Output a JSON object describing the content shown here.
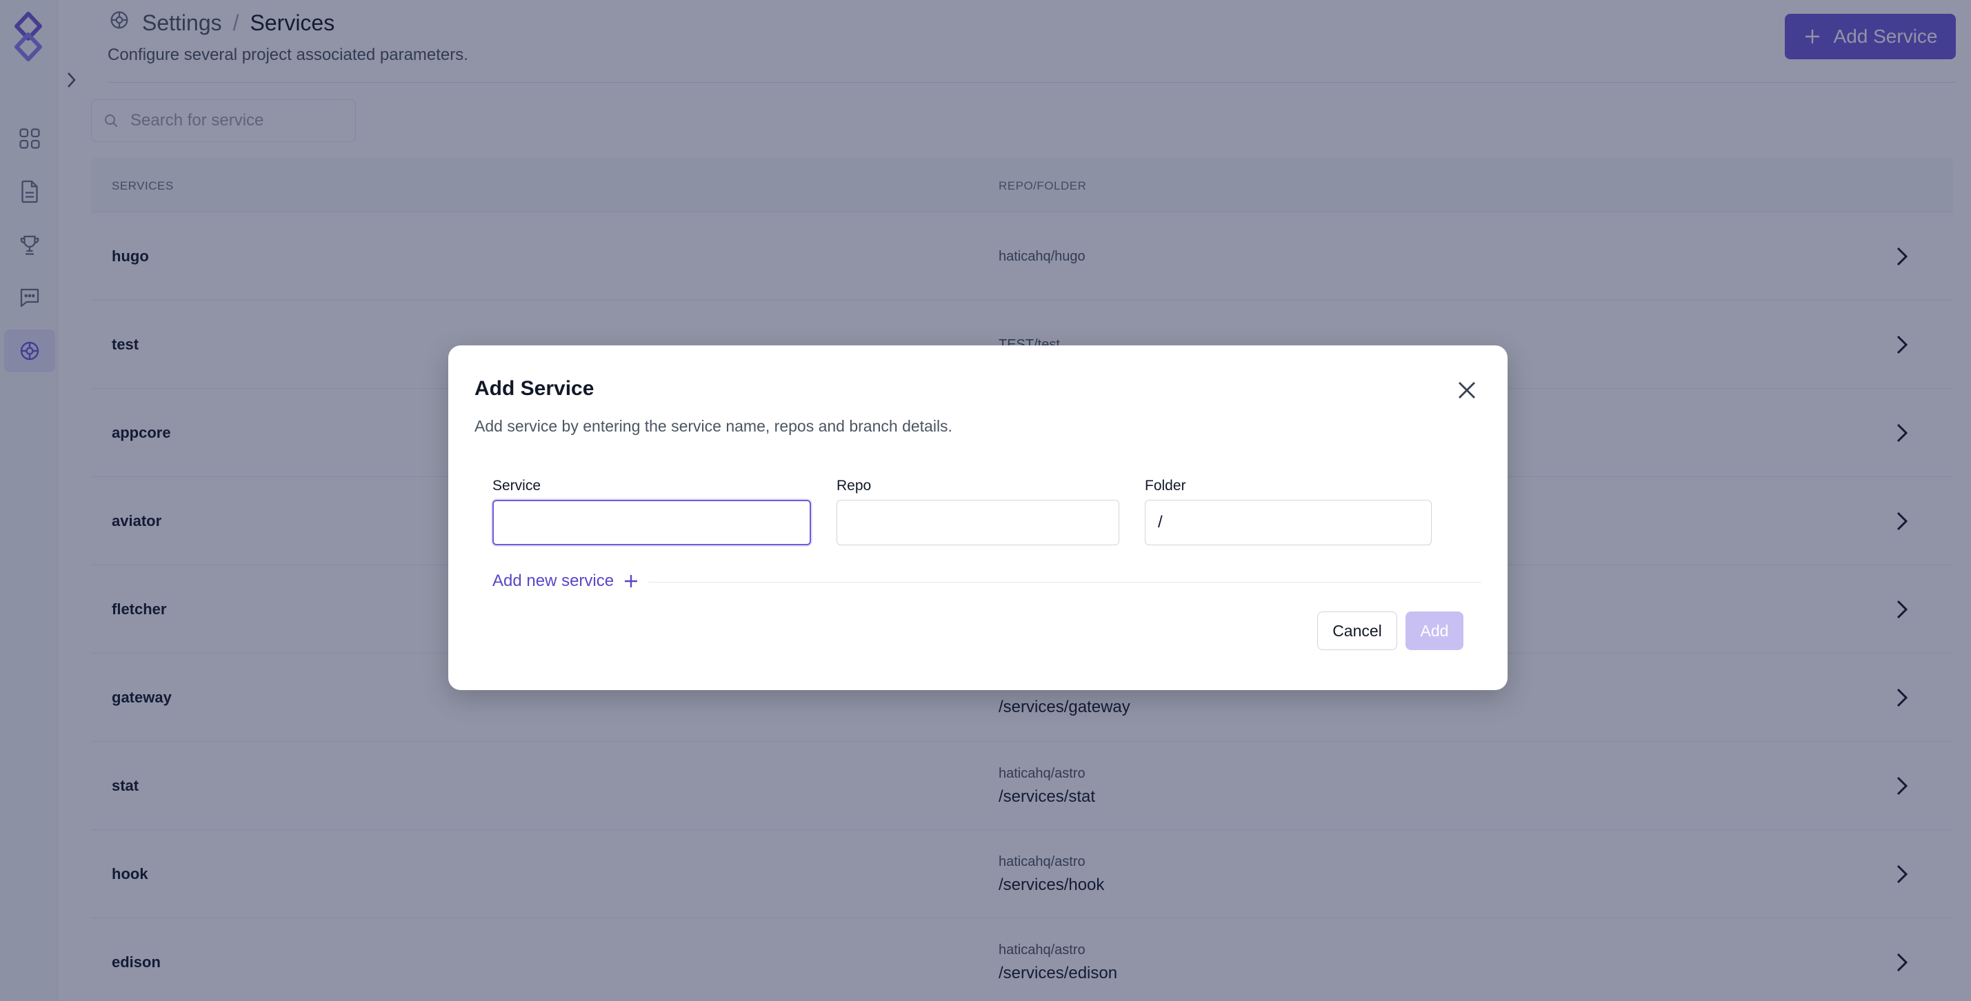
{
  "header": {
    "breadcrumb_root": "Settings",
    "breadcrumb_sep": "/",
    "breadcrumb_current": "Services",
    "subtitle": "Configure several project associated parameters.",
    "add_service_label": "Add Service"
  },
  "search": {
    "placeholder": "Search for service"
  },
  "table": {
    "col_services": "SERVICES",
    "col_repo": "REPO/FOLDER",
    "rows": [
      {
        "name": "hugo",
        "repo": "haticahq/hugo",
        "folder": ""
      },
      {
        "name": "test",
        "repo": "TEST/test",
        "folder": ""
      },
      {
        "name": "appcore",
        "repo": "",
        "folder": ""
      },
      {
        "name": "aviator",
        "repo": "",
        "folder": ""
      },
      {
        "name": "fletcher",
        "repo": "",
        "folder": ""
      },
      {
        "name": "gateway",
        "repo": "",
        "folder": "/services/gateway"
      },
      {
        "name": "stat",
        "repo": "haticahq/astro",
        "folder": "/services/stat"
      },
      {
        "name": "hook",
        "repo": "haticahq/astro",
        "folder": "/services/hook"
      },
      {
        "name": "edison",
        "repo": "haticahq/astro",
        "folder": "/services/edison"
      }
    ]
  },
  "modal": {
    "title": "Add Service",
    "description": "Add service by entering the service name, repos and branch details.",
    "service_label": "Service",
    "service_value": "",
    "repo_label": "Repo",
    "repo_value": "",
    "folder_label": "Folder",
    "folder_value": "/",
    "add_new_label": "Add new service",
    "cancel_label": "Cancel",
    "add_label": "Add"
  },
  "colors": {
    "accent": "#6e5bd9",
    "accent_disabled": "#c8c0f3",
    "overlay": "rgba(22,32,68,0.48)"
  },
  "icons": {
    "sidebar": [
      "dashboard-icon",
      "document-icon",
      "trophy-icon",
      "chat-icon",
      "settings-icon"
    ],
    "breadcrumb": "settings-icon",
    "search": "search-icon",
    "close": "close-icon",
    "row": "chevron-right-icon"
  }
}
